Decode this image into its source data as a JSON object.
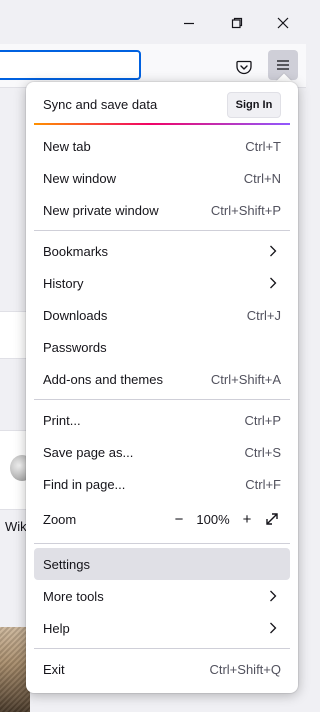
{
  "window": {
    "minimize_icon": "minimize-icon",
    "restore_icon": "restore-icon",
    "close_icon": "close-icon"
  },
  "toolbar": {
    "pocket_icon": "pocket-icon",
    "menu_icon": "hamburger-menu-icon"
  },
  "page": {
    "partial_text": "Wiki"
  },
  "menu": {
    "sync_label": "Sync and save data",
    "signin_label": "Sign In",
    "new_tab": {
      "label": "New tab",
      "shortcut": "Ctrl+T"
    },
    "new_window": {
      "label": "New window",
      "shortcut": "Ctrl+N"
    },
    "new_private_window": {
      "label": "New private window",
      "shortcut": "Ctrl+Shift+P"
    },
    "bookmarks": {
      "label": "Bookmarks"
    },
    "history": {
      "label": "History"
    },
    "downloads": {
      "label": "Downloads",
      "shortcut": "Ctrl+J"
    },
    "passwords": {
      "label": "Passwords"
    },
    "addons": {
      "label": "Add-ons and themes",
      "shortcut": "Ctrl+Shift+A"
    },
    "print": {
      "label": "Print...",
      "shortcut": "Ctrl+P"
    },
    "save_page": {
      "label": "Save page as...",
      "shortcut": "Ctrl+S"
    },
    "find": {
      "label": "Find in page...",
      "shortcut": "Ctrl+F"
    },
    "zoom": {
      "label": "Zoom",
      "minus": "−",
      "value": "100%",
      "plus": "+"
    },
    "settings": {
      "label": "Settings"
    },
    "more_tools": {
      "label": "More tools"
    },
    "help": {
      "label": "Help"
    },
    "exit": {
      "label": "Exit",
      "shortcut": "Ctrl+Shift+Q"
    }
  },
  "colors": {
    "accent": "#0061e0",
    "highlight": "#e0e0e6",
    "sync_gradient": [
      "#ff9100",
      "#f10366",
      "#9059ff"
    ]
  }
}
